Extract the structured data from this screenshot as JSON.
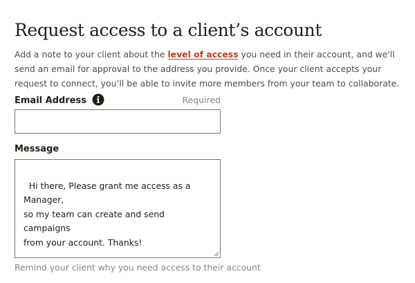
{
  "page": {
    "title": "Request access to a client’s account",
    "intro_before_link": "Add a note to your client about the ",
    "intro_link": "level of access",
    "intro_after_link": " you need in their account, and we'll send an email for approval to the address you provide. Once your client accepts your request to connect, you’ll be able to invite more members from your team to collaborate."
  },
  "email": {
    "label": "Email Address",
    "icon": "info-icon",
    "required_label": "Required",
    "value": ""
  },
  "message": {
    "label": "Message",
    "value": "Hi there, Please grant me access as a Manager,\nso my team can create and send campaigns\nfrom your account. Thanks!",
    "helper": "Remind your client why you need access to their account"
  },
  "colors": {
    "text": "#241c15",
    "link": "#b33c22",
    "muted": "#8a8580",
    "border": "#7a7470"
  }
}
